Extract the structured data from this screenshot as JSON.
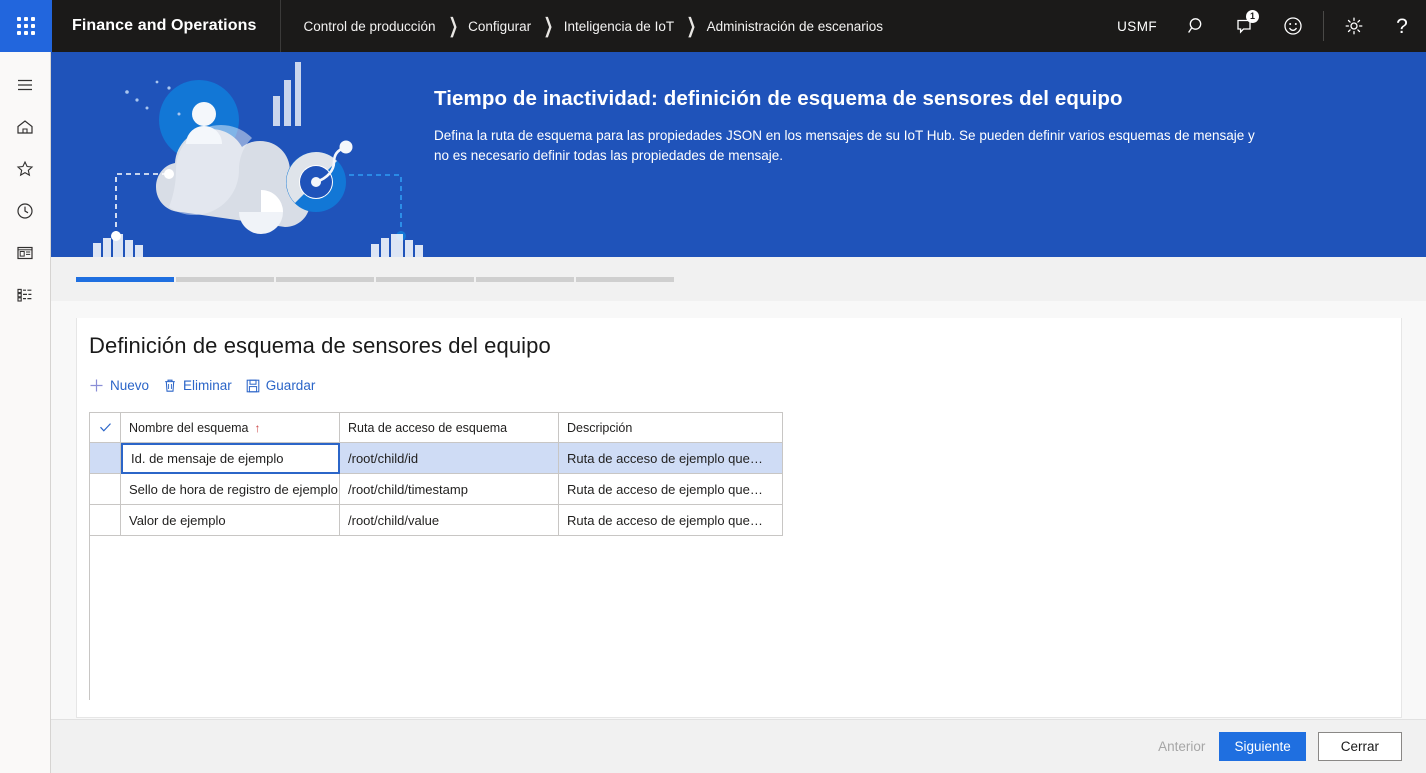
{
  "topbar": {
    "brand": "Finance and Operations",
    "waffle_icon": "app-launcher-icon",
    "breadcrumb": [
      "Control de producción",
      "Configurar",
      "Inteligencia de IoT",
      "Administración de escenarios"
    ],
    "company": "USMF",
    "search_icon": "search-icon",
    "notifications_icon": "notification-bubble-icon",
    "notifications_count": "1",
    "feedback_icon": "smiley-face-icon",
    "settings_icon": "gear-icon",
    "help_icon": "question-mark-icon"
  },
  "rail": {
    "items": [
      {
        "icon": "hamburger-menu-icon",
        "name": "menu"
      },
      {
        "icon": "home-icon",
        "name": "home"
      },
      {
        "icon": "star-icon",
        "name": "favorites"
      },
      {
        "icon": "clock-icon",
        "name": "recent"
      },
      {
        "icon": "workspaces-icon",
        "name": "workspaces"
      },
      {
        "icon": "modules-list-icon",
        "name": "modules"
      }
    ]
  },
  "hero": {
    "title": "Tiempo de inactividad: definición de esquema de sensores del equipo",
    "subtitle": "Defina la ruta de esquema para las propiedades JSON en los mensajes de su IoT Hub. Se pueden definir varios esquemas de mensaje y no es necesario definir todas las propiedades de mensaje.",
    "background_color": "#1f53ba",
    "illustration": "cloud-iot-illustration"
  },
  "steps": {
    "total": 6,
    "active_index": 0,
    "active_color": "#1f6fe0",
    "inactive_color": "#cfcfcf"
  },
  "card": {
    "title": "Definición de esquema de sensores del equipo",
    "toolbar": [
      {
        "label": "Nuevo",
        "icon": "plus-icon"
      },
      {
        "label": "Eliminar",
        "icon": "trash-icon"
      },
      {
        "label": "Guardar",
        "icon": "save-disk-icon"
      }
    ],
    "grid": {
      "headers": {
        "check": "select-all-checkmark",
        "name": "Nombre del esquema",
        "name_sort": "↑",
        "path": "Ruta de acceso de esquema",
        "description": "Descripción"
      },
      "rows": [
        {
          "name": "Id. de mensaje de ejemplo",
          "path": "/root/child/id",
          "description": "Ruta de acceso de ejemplo que…",
          "selected": true
        },
        {
          "name": "Sello de hora de registro de ejemplo",
          "path": "/root/child/timestamp",
          "description": "Ruta de acceso de ejemplo que…",
          "selected": false
        },
        {
          "name": "Valor de ejemplo",
          "path": "/root/child/value",
          "description": "Ruta de acceso de ejemplo que…",
          "selected": false
        }
      ]
    }
  },
  "footer": {
    "previous": "Anterior",
    "next": "Siguiente",
    "close": "Cerrar",
    "next_color": "#1f6fe0"
  }
}
